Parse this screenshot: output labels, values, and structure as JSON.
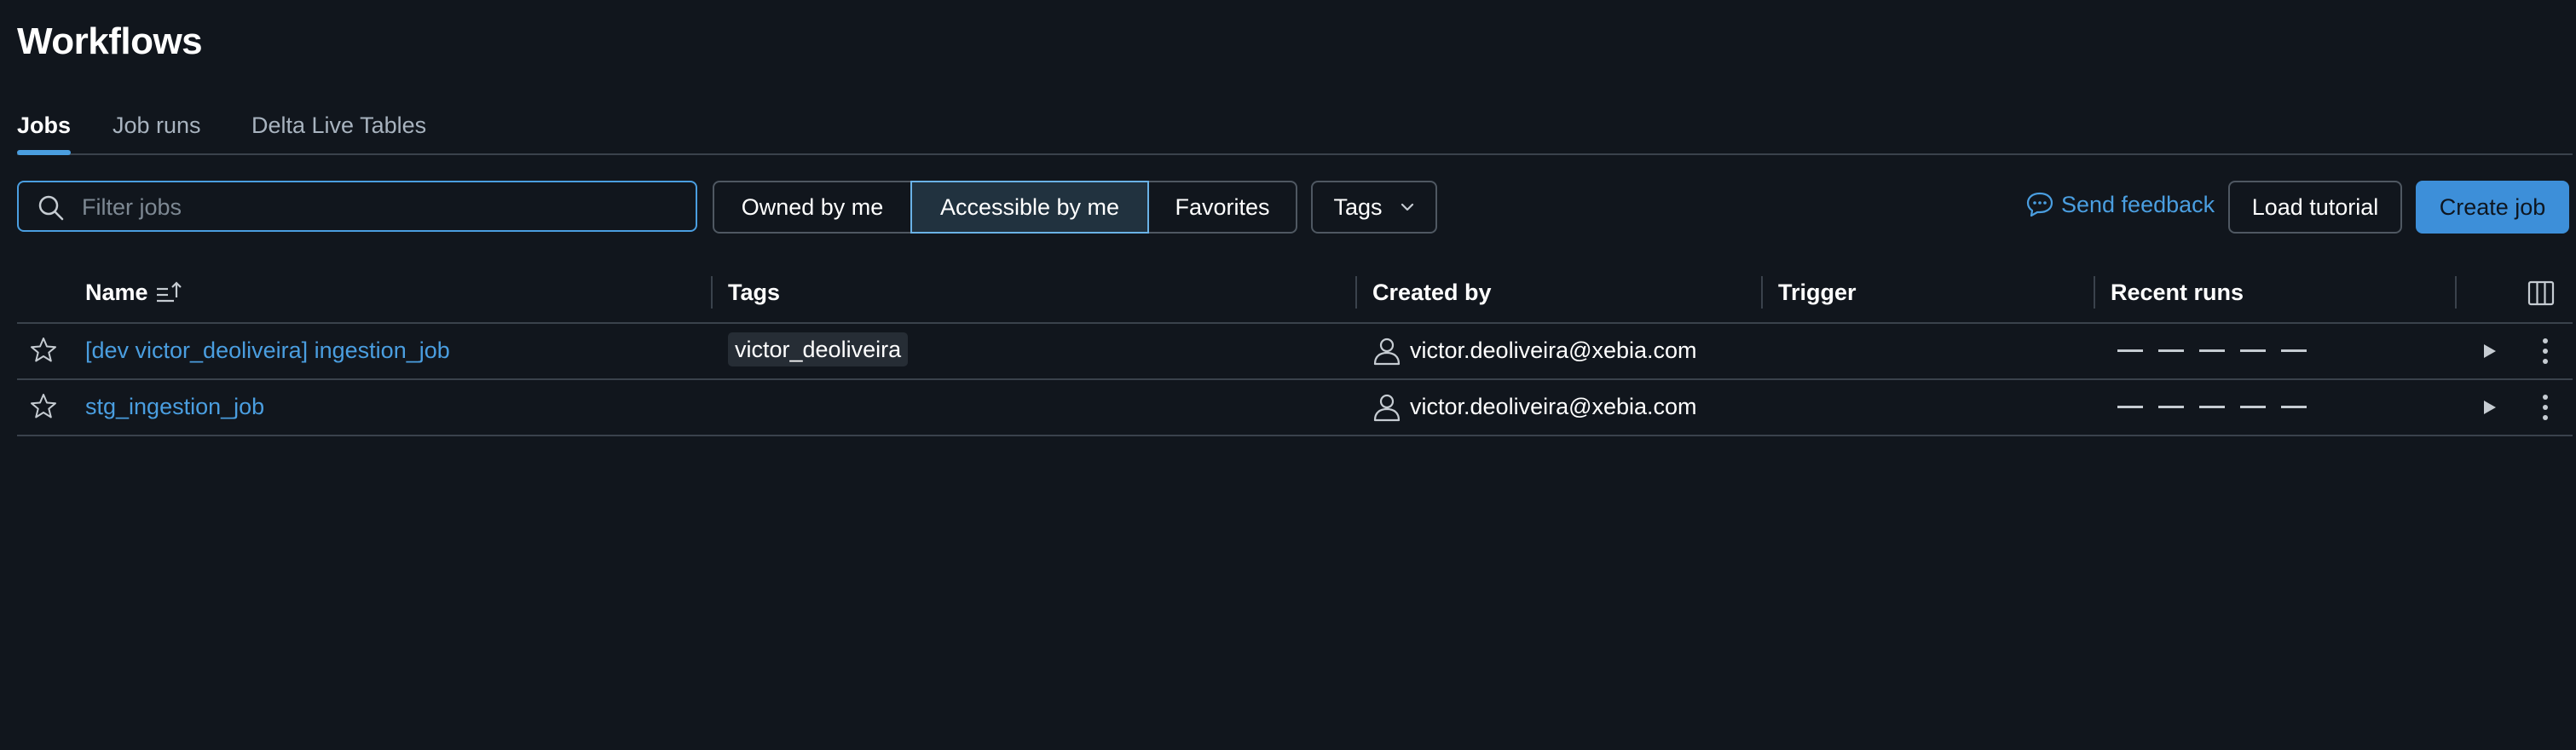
{
  "page": {
    "title": "Workflows"
  },
  "tabs": [
    {
      "label": "Jobs",
      "active": true
    },
    {
      "label": "Job runs",
      "active": false
    },
    {
      "label": "Delta Live Tables",
      "active": false
    }
  ],
  "toolbar": {
    "search_placeholder": "Filter jobs",
    "search_value": "",
    "filters": [
      {
        "label": "Owned by me",
        "selected": false
      },
      {
        "label": "Accessible by me",
        "selected": true
      },
      {
        "label": "Favorites",
        "selected": false
      }
    ],
    "tags_dropdown_label": "Tags",
    "feedback_label": "Send feedback",
    "load_tutorial_label": "Load tutorial",
    "create_job_label": "Create job"
  },
  "table": {
    "columns": {
      "name": "Name",
      "tags": "Tags",
      "created_by": "Created by",
      "trigger": "Trigger",
      "recent_runs": "Recent runs"
    },
    "rows": [
      {
        "name": "[dev victor_deoliveira] ingestion_job",
        "tag": "victor_deoliveira",
        "created_by": "victor.deoliveira@xebia.com",
        "trigger": ""
      },
      {
        "name": "stg_ingestion_job",
        "tag": "",
        "created_by": "victor.deoliveira@xebia.com",
        "trigger": ""
      }
    ]
  },
  "colors": {
    "background": "#11161d",
    "accent": "#4a9ee0",
    "primary_button": "#3d8fd9",
    "selected_filter_bg": "#21323f",
    "border": "#3a424c"
  },
  "icons": {
    "search": "search-icon",
    "feedback": "speech-bubble-icon",
    "chevron": "chevron-down-icon",
    "sort": "sort-ascending-icon",
    "columns": "columns-icon",
    "star": "star-outline-icon",
    "user": "user-icon",
    "run": "play-icon",
    "more": "kebab-menu-icon"
  }
}
